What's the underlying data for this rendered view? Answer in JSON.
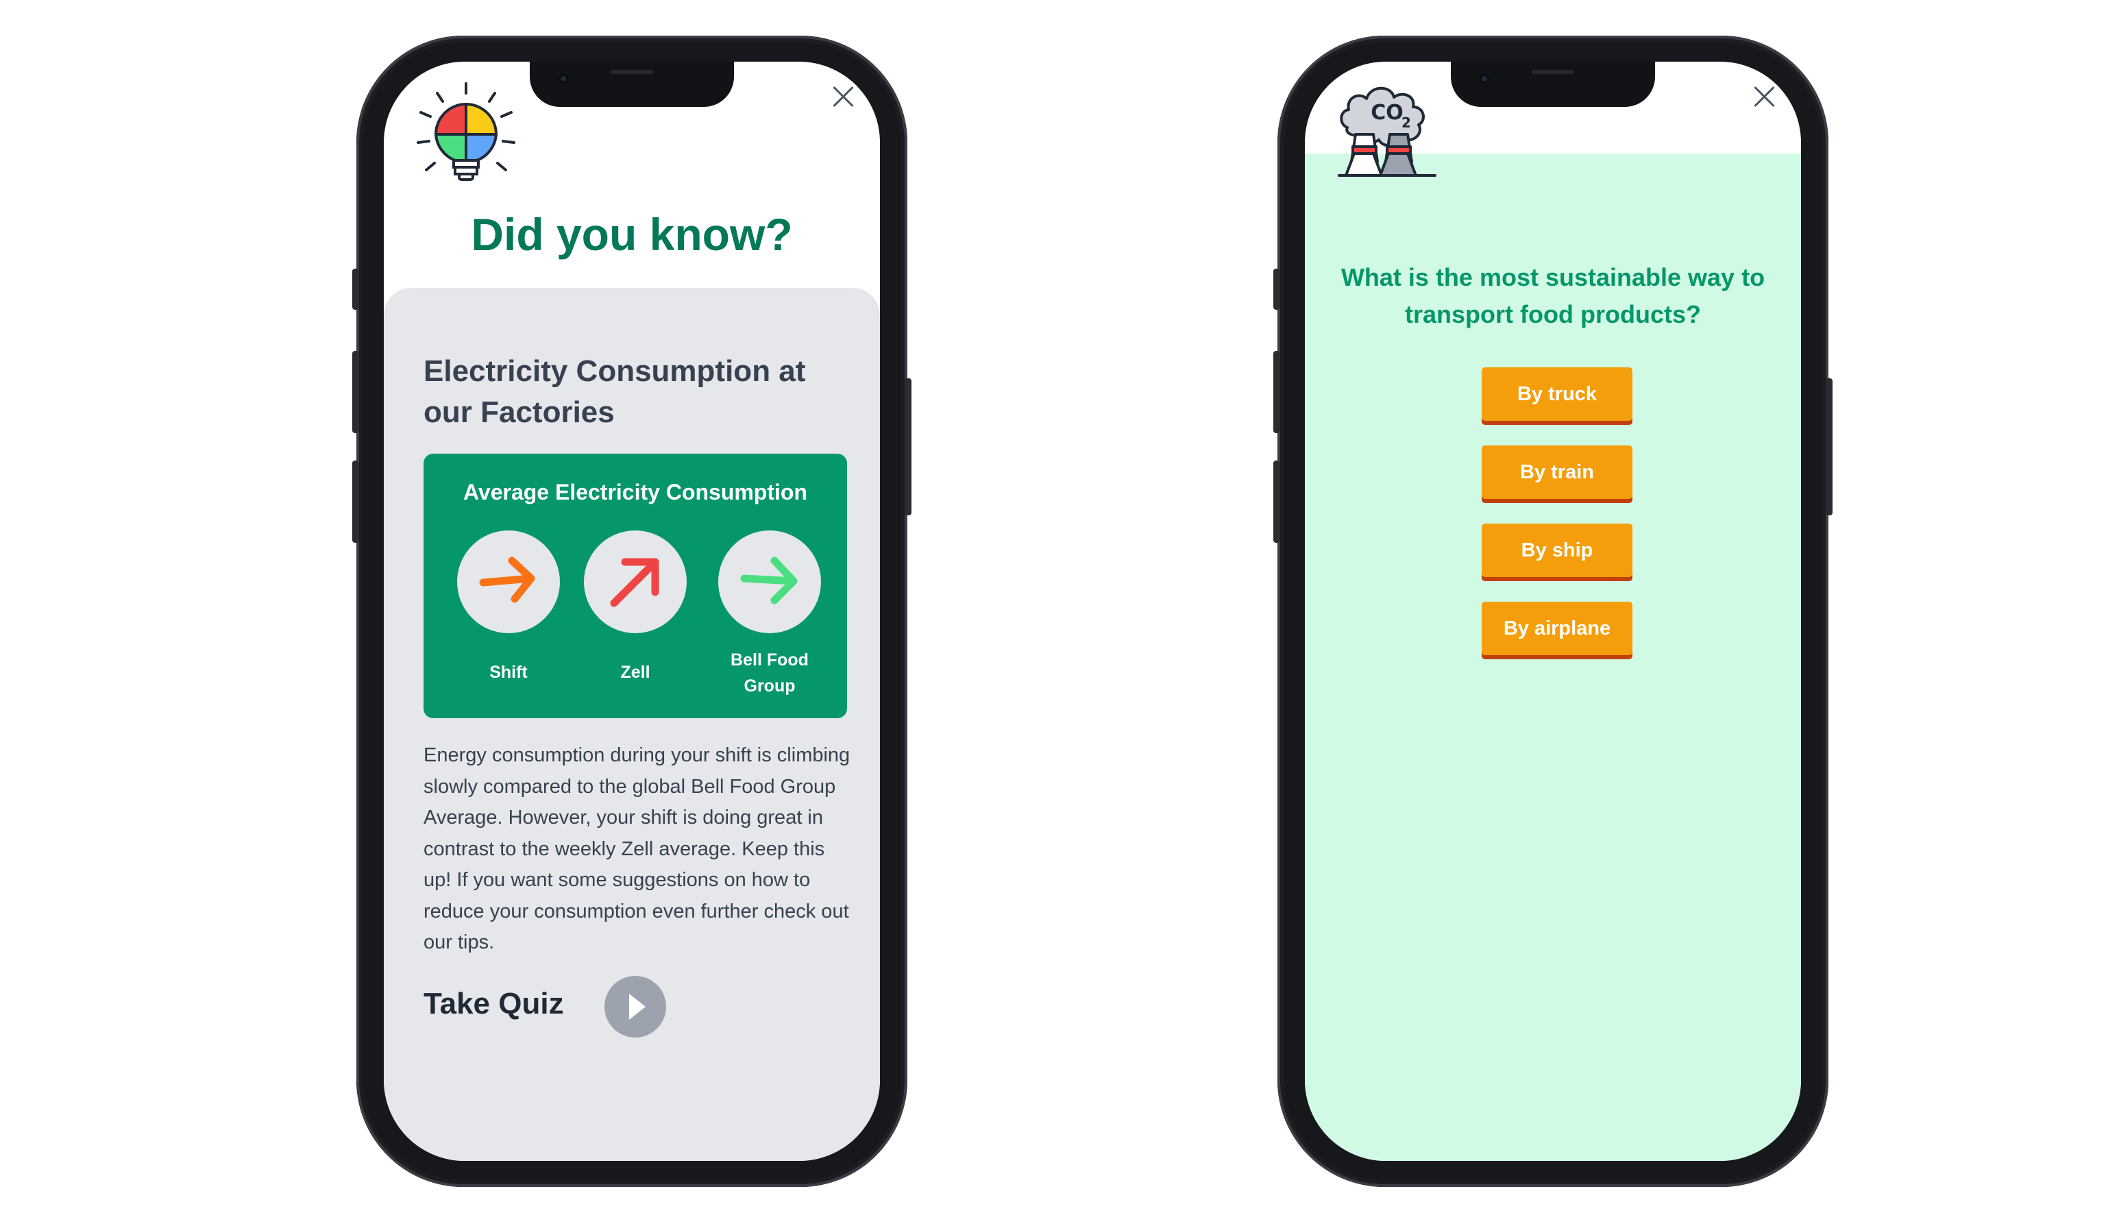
{
  "info_screen": {
    "heading": "Did you know?",
    "card_title": "Electricity Consumption at our Factories",
    "stats_title": "Average Electricity Consumption",
    "stats": [
      {
        "label": "Shift",
        "trend": "slowly-rising",
        "color": "#f97316"
      },
      {
        "label": "Zell",
        "trend": "rising",
        "color": "#ef4444"
      },
      {
        "label": "Bell Food Group",
        "trend": "flat",
        "color": "#4ade80"
      }
    ],
    "description": "Energy consumption during your shift is climbing slowly compared to the global Bell Food Group Average. However, your shift is doing great in contrast to the weekly Zell average. Keep this up! If you want some suggestions on how to reduce your consumption even further check out our tips.",
    "take_quiz_label": "Take Quiz",
    "icons": {
      "header": "lightbulb-puzzle-icon",
      "close": "close-icon",
      "play": "play-icon"
    }
  },
  "quiz_screen": {
    "question": "What is the most sustainable way to transport food products?",
    "answers": [
      "By truck",
      "By train",
      "By ship",
      "By airplane"
    ],
    "icons": {
      "header": "co2-factory-icon",
      "close": "close-icon"
    }
  },
  "colors": {
    "heading_green": "#047857",
    "box_green": "#059669",
    "card_gray": "#e5e7eb",
    "quiz_bg": "#d1fae5",
    "answer_orange": "#f59e0b"
  }
}
